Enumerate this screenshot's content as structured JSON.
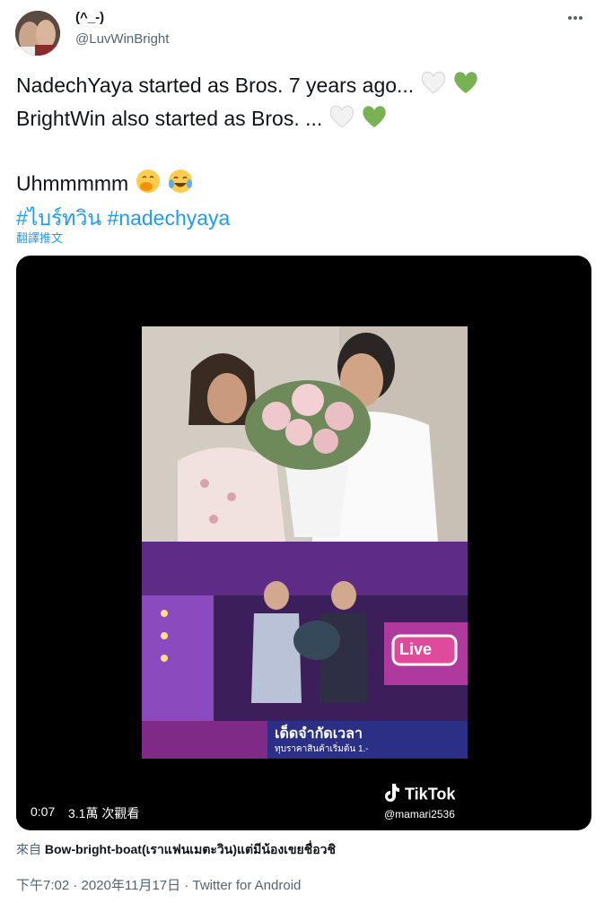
{
  "user": {
    "display_name": "(^_-)",
    "handle": "@LuvWinBright"
  },
  "tweet": {
    "line1": "NadechYaya started as Bros. 7 years ago...",
    "line2": "BrightWin also started as Bros. ...",
    "line3": "Uhmmmmm",
    "hashtag1": "#ไบร์ทวิน",
    "hashtag2": "#nadechyaya"
  },
  "translate_label": "翻譯推文",
  "video": {
    "time": "0:07",
    "views": "3.1萬 次觀看",
    "caption_line1": "เด็ดจำกัดเวลา",
    "caption_line2": "ทุบราคาสินค้าเริ่มต้น 1.-",
    "live_badge": "Live",
    "tiktok_logo": "TikTok",
    "tiktok_user": "@mamari2536"
  },
  "source": {
    "prefix": "來自",
    "name": "Bow-bright-boat(เราแฟนเมตะวิน)แต่มีน้องเขยชื่อวชิ"
  },
  "meta": "下午7:02 · 2020年11月17日 · Twitter for Android",
  "icons": [
    "more-icon",
    "white-heart-icon",
    "green-heart-icon",
    "face-hand-over-mouth-icon",
    "tears-of-joy-icon",
    "tiktok-note-icon"
  ]
}
